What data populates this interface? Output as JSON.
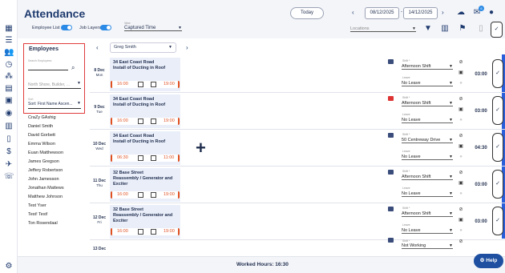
{
  "app": {
    "title": "Attendance"
  },
  "toolbar": {
    "today_label": "Today",
    "date_from": "08/12/2025",
    "date_to": "14/12/2025",
    "notification_count": "6",
    "employee_list_label": "Employee List",
    "job_layers_label": "Job Layers",
    "view_label": "View",
    "view_value": "Captured Time",
    "locations_placeholder": "Locations"
  },
  "filters": {
    "title": "Employees",
    "search_label": "Search Employees",
    "search_value": "",
    "location_placeholder": "North Shore, Builder, ...",
    "sort_label": "Sort",
    "sort_value": "Sort: First Name Ascen..."
  },
  "employees": [
    "CraZy GAshig",
    "Daniel Smith",
    "David Gorbett",
    "Emma Wilson",
    "Euan Matthewson",
    "James Gregson",
    "Jeffery Robertson",
    "John Jamesson",
    "Jonathan Mattews",
    "Matthew Johnson",
    "Test Yser",
    "Test! Test!",
    "Ton Rosendaal"
  ],
  "selected_employee": "Greg Smith",
  "days": [
    {
      "num": "8 Dec",
      "dow": "Mon",
      "loc": "34 East Coast Road",
      "task": "Install of Ducting in Roof",
      "start": "16:00",
      "end": "19:00",
      "shift_label": "Shift *",
      "shift": "Afternoon Shift",
      "leave_label": "Leave",
      "leave": "No Leave",
      "hours": "03:00"
    },
    {
      "num": "9 Dec",
      "dow": "Tue",
      "loc": "34 East Coast Road",
      "task": "Install of Ducting in Roof",
      "start": "16:00",
      "end": "19:00",
      "shift_label": "Shift *",
      "shift": "Afternoon Shift",
      "leave_label": "Leave",
      "leave": "No Leave",
      "hours": "03:00"
    },
    {
      "num": "10 Dec",
      "dow": "Wed",
      "loc": "34 East Coast Road",
      "task": "Install of Ducting in Roof",
      "start": "06:30",
      "end": "11:00",
      "shift_label": "Shift *",
      "shift": "50 Centreway Drive",
      "leave_label": "Leave",
      "leave": "No Leave",
      "hours": "04:30"
    },
    {
      "num": "11 Dec",
      "dow": "Thu",
      "loc": "32 Base Street",
      "task": "Reassembly / Generator and Exciter",
      "start": "16:00",
      "end": "19:00",
      "shift_label": "Shift *",
      "shift": "Afternoon Shift",
      "leave_label": "Leave",
      "leave": "No Leave",
      "hours": "03:00"
    },
    {
      "num": "12 Dec",
      "dow": "Fri",
      "loc": "32 Base Street",
      "task": "Reassembly / Generator and Exciter",
      "start": "16:00",
      "end": "19:00",
      "shift_label": "Shift *",
      "shift": "Afternoon Shift",
      "leave_label": "Leave",
      "leave": "No Leave",
      "hours": "03:00"
    }
  ],
  "partial_row": {
    "shift_label": "Shift *",
    "shift": "Not Working"
  },
  "footer": {
    "worked_hours": "Worked Hours: 16:30"
  },
  "help_label": "Help",
  "colors": {
    "accent": "#2b8ae6",
    "brand": "#1e3a6e",
    "time": "#e05020"
  }
}
